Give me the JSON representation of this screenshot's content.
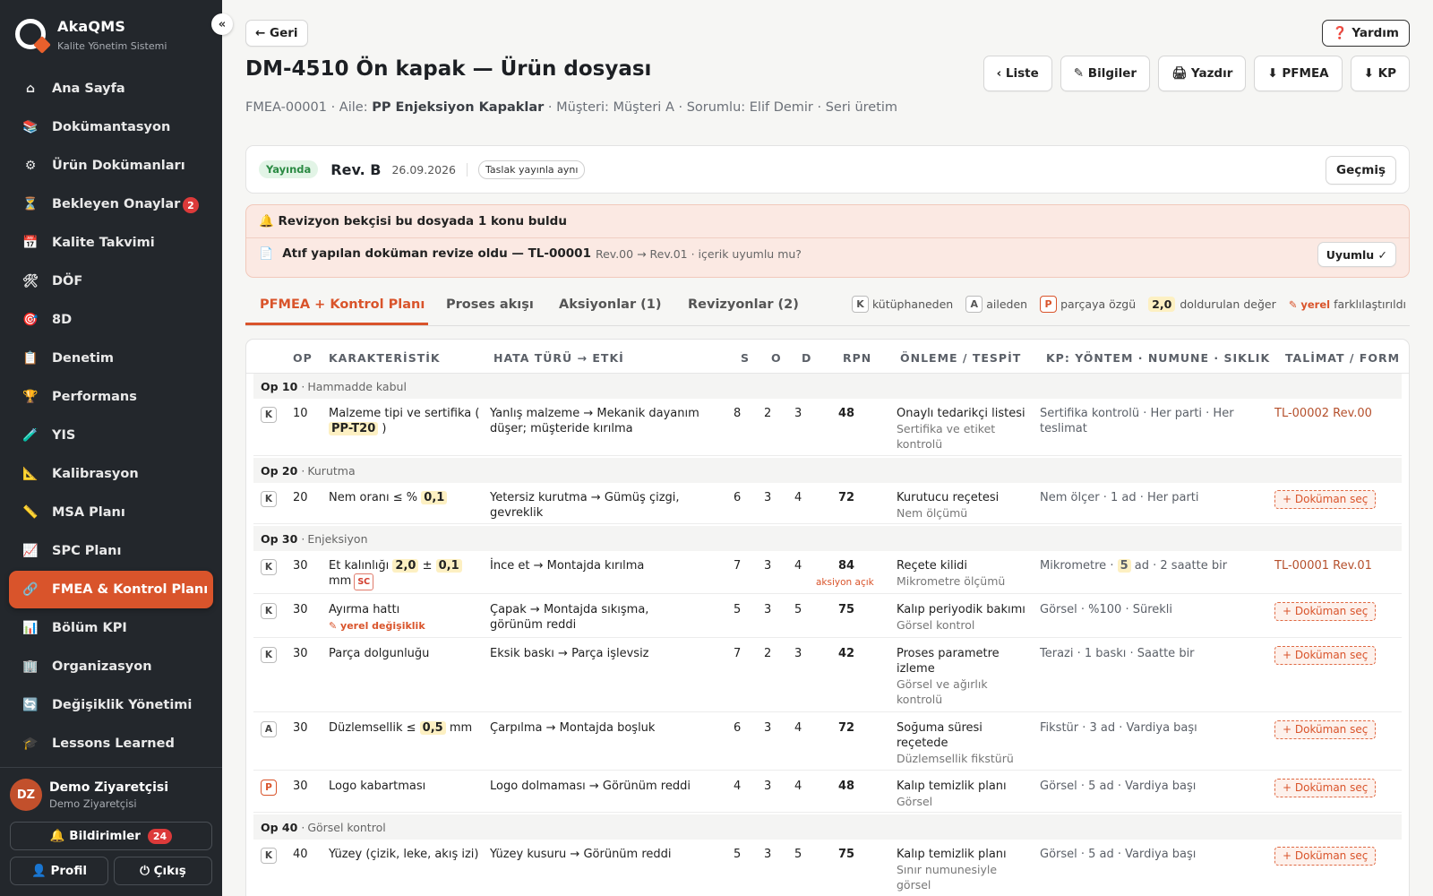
{
  "sidebar": {
    "brand_name": "AkaQMS",
    "brand_sub": "Kalite Yönetim Sistemi",
    "collapse": "«",
    "items": [
      {
        "icon": "⌂",
        "label": "Ana Sayfa"
      },
      {
        "icon": "📚",
        "label": "Dokümantasyon"
      },
      {
        "icon": "⚙",
        "label": "Ürün Dokümanları"
      },
      {
        "icon": "⏳",
        "label": "Bekleyen Onaylar",
        "badge": "2"
      },
      {
        "icon": "📅",
        "label": "Kalite Takvimi"
      },
      {
        "icon": "🛠",
        "label": "DÖF"
      },
      {
        "icon": "🎯",
        "label": "8D"
      },
      {
        "icon": "📋",
        "label": "Denetim"
      },
      {
        "icon": "🏆",
        "label": "Performans"
      },
      {
        "icon": "🧪",
        "label": "YIS"
      },
      {
        "icon": "📐",
        "label": "Kalibrasyon"
      },
      {
        "icon": "📏",
        "label": "MSA Planı"
      },
      {
        "icon": "📈",
        "label": "SPC Planı"
      },
      {
        "icon": "🔗",
        "label": "FMEA & Kontrol Planı"
      },
      {
        "icon": "📊",
        "label": "Bölüm KPI"
      },
      {
        "icon": "🏢",
        "label": "Organizasyon"
      },
      {
        "icon": "🔄",
        "label": "Değişiklik Yönetimi"
      },
      {
        "icon": "🎓",
        "label": "Lessons Learned"
      }
    ],
    "active_index": 13,
    "user": {
      "initials": "DZ",
      "name": "Demo Ziyaretçisi",
      "role": "Demo Ziyaretçisi"
    },
    "notifications_label": "🔔 Bildirimler",
    "notifications_count": "24",
    "profile_label": "👤 Profil",
    "logout_label": "⏻ Çıkış"
  },
  "header": {
    "back": "← Geri",
    "help": "❓ Yardım",
    "title": "DM-4510 Ön kapak — Ürün dosyası",
    "actions": [
      "‹ Liste",
      "✎ Bilgiler",
      "🖨 Yazdır",
      "⬇ PFMEA",
      "⬇ KP"
    ],
    "meta_prefix": "FMEA-00001 · Aile: ",
    "meta_family": "PP Enjeksiyon Kapaklar",
    "meta_suffix": " · Müşteri: Müşteri A · Sorumlu: Elif Demir · Seri üretim"
  },
  "revision": {
    "status": "Yayında",
    "rev": "Rev. B",
    "date": "26.09.2026",
    "chip": "Taslak yayınla aynı",
    "history": "Geçmiş"
  },
  "alert": {
    "title": "🔔 Revizyon bekçisi bu dosyada 1 konu buldu",
    "item_bold": "Atıf yapılan doküman revize oldu — TL-00001",
    "item_muted": "Rev.00 → Rev.01 · içerik uyumlu mu?",
    "button": "Uyumlu ✓"
  },
  "tabs": [
    "PFMEA + Kontrol Planı",
    "Proses akışı",
    "Aksiyonlar (1)",
    "Revizyonlar (2)"
  ],
  "legend": {
    "k": "K",
    "k_label": "kütüphaneden",
    "a": "A",
    "a_label": "aileden",
    "p": "P",
    "p_label": "parçaya özgü",
    "val": "2,0",
    "val_label": "doldurulan değer",
    "local": "✎ yerel",
    "local_label": "farklılaştırıldı"
  },
  "table": {
    "headers": [
      "OP",
      "KARAKTERİSTİK",
      "HATA TÜRÜ → ETKİ",
      "S",
      "O",
      "D",
      "RPN",
      "ÖNLEME / TESPİT",
      "KP: YÖNTEM · NUMUNE · SIKLIK",
      "TALİMAT / FORM"
    ],
    "groups": [
      {
        "op": "Op 10",
        "name": "Hammadde kabul"
      },
      {
        "op": "Op 20",
        "name": "Kurutma"
      },
      {
        "op": "Op 30",
        "name": "Enjeksiyon"
      },
      {
        "op": "Op 40",
        "name": "Görsel kontrol"
      }
    ],
    "rows": [
      {
        "src": "K",
        "op": "10",
        "char_pre": "Malzeme tipi ve sertifika (",
        "char_hl": "PP-T20",
        "char_post": ")",
        "fail": "Yanlış malzeme → Mekanik dayanım düşer; müşteride kırılma",
        "s": "8",
        "o": "2",
        "d": "3",
        "rpn": "48",
        "prev": "Onaylı tedarikçi listesi",
        "det": "Sertifika ve etiket kontrolü",
        "kp": "Sertifika kontrolü · Her parti · Her teslimat",
        "doc": "TL-00002 Rev.00"
      },
      {
        "src": "K",
        "op": "20",
        "char_pre": "Nem oranı ≤ %",
        "char_hl": "0,1",
        "char_post": "",
        "fail": "Yetersiz kurutma → Gümüş çizgi, gevreklik",
        "s": "6",
        "o": "3",
        "d": "4",
        "rpn": "72",
        "prev": "Kurutucu reçetesi",
        "det": "Nem ölçümü",
        "kp": "Nem ölçer · 1 ad · Her parti",
        "doc": "+ Doküman seç"
      },
      {
        "src": "K",
        "op": "30",
        "char_pre": "Et kalınlığı",
        "char_hl": "2,0",
        "char_mid": "±",
        "char_hl2": "0,1",
        "char_post": "mm",
        "sc": "SC",
        "fail": "İnce et → Montajda kırılma",
        "s": "7",
        "o": "3",
        "d": "4",
        "rpn": "84",
        "rpn_note": "aksiyon açık",
        "prev": "Reçete kilidi",
        "det": "Mikrometre ölçümü",
        "kp_pre": "Mikrometre ·",
        "kp_hl": "5",
        "kp_post": "ad · 2 saatte bir",
        "doc": "TL-00001 Rev.01"
      },
      {
        "src": "K",
        "op": "30",
        "char_pre": "Ayırma hattı",
        "local": "✎ yerel değişiklik",
        "fail": "Çapak → Montajda sıkışma, görünüm reddi",
        "s": "5",
        "o": "3",
        "d": "5",
        "rpn": "75",
        "prev": "Kalıp periyodik bakımı",
        "det": "Görsel kontrol",
        "kp": "Görsel · %100 · Sürekli",
        "doc": "+ Doküman seç"
      },
      {
        "src": "K",
        "op": "30",
        "char_pre": "Parça dolgunluğu",
        "fail": "Eksik baskı → Parça işlevsiz",
        "s": "7",
        "o": "2",
        "d": "3",
        "rpn": "42",
        "prev": "Proses parametre izleme",
        "det": "Görsel ve ağırlık kontrolü",
        "kp": "Terazi · 1 baskı · Saatte bir",
        "doc": "+ Doküman seç"
      },
      {
        "src": "A",
        "op": "30",
        "char_pre": "Düzlemsellik ≤",
        "char_hl": "0,5",
        "char_post": "mm",
        "fail": "Çarpılma → Montajda boşluk",
        "s": "6",
        "o": "3",
        "d": "4",
        "rpn": "72",
        "prev": "Soğuma süresi reçetede",
        "det": "Düzlemsellik fikstürü",
        "kp": "Fikstür · 3 ad · Vardiya başı",
        "doc": "+ Doküman seç"
      },
      {
        "src": "P",
        "op": "30",
        "char_pre": "Logo kabartması",
        "fail": "Logo dolmaması → Görünüm reddi",
        "s": "4",
        "o": "3",
        "d": "4",
        "rpn": "48",
        "prev": "Kalıp temizlik planı",
        "det": "Görsel",
        "kp": "Görsel · 5 ad · Vardiya başı",
        "doc": "+ Doküman seç"
      },
      {
        "src": "K",
        "op": "40",
        "char_pre": "Yüzey (çizik, leke, akış izi)",
        "fail": "Yüzey kusuru → Görünüm reddi",
        "s": "5",
        "o": "3",
        "d": "5",
        "rpn": "75",
        "prev": "Kalıp temizlik planı",
        "det": "Sınır numunesiyle görsel",
        "kp": "Görsel · 5 ad · Vardiya başı",
        "doc": "+ Doküman seç"
      }
    ]
  }
}
